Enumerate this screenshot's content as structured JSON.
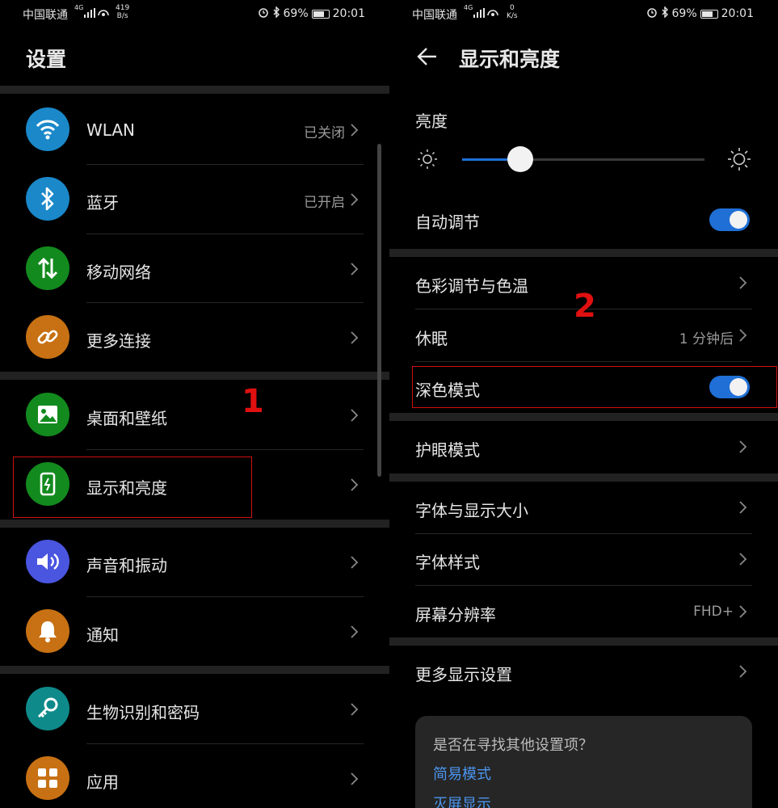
{
  "left": {
    "status": {
      "carrier": "中国联通",
      "net": "4G",
      "speed_num": "419",
      "speed_unit": "B/s",
      "battery": "69%",
      "time": "20:01"
    },
    "title": "设置",
    "items": [
      {
        "label": "WLAN",
        "value": "已关闭",
        "icon": "wifi-icon",
        "color": "#1a88c9"
      },
      {
        "label": "蓝牙",
        "value": "已开启",
        "icon": "bluetooth-icon",
        "color": "#1a88c9"
      },
      {
        "label": "移动网络",
        "value": "",
        "icon": "mobile-network-icon",
        "color": "#138a1e"
      },
      {
        "label": "更多连接",
        "value": "",
        "icon": "link-icon",
        "color": "#c77114"
      },
      {
        "label": "桌面和壁纸",
        "value": "",
        "icon": "wallpaper-icon",
        "color": "#138a1e"
      },
      {
        "label": "显示和亮度",
        "value": "",
        "icon": "display-icon",
        "color": "#138a1e"
      },
      {
        "label": "声音和振动",
        "value": "",
        "icon": "sound-icon",
        "color": "#4a55e0"
      },
      {
        "label": "通知",
        "value": "",
        "icon": "bell-icon",
        "color": "#c77114"
      },
      {
        "label": "生物识别和密码",
        "value": "",
        "icon": "key-icon",
        "color": "#0f8a8a"
      },
      {
        "label": "应用",
        "value": "",
        "icon": "apps-icon",
        "color": "#c77114"
      }
    ],
    "annotation": "1"
  },
  "right": {
    "status": {
      "carrier": "中国联通",
      "net": "4G",
      "speed_num": "0",
      "speed_unit": "K/s",
      "battery": "69%",
      "time": "20:01"
    },
    "title": "显示和亮度",
    "brightness_label": "亮度",
    "brightness_level": 0.24,
    "auto_adjust": "自动调节",
    "color_temp": "色彩调节与色温",
    "sleep": "休眠",
    "sleep_value": "1 分钟后",
    "dark_mode": "深色模式",
    "eye_care": "护眼模式",
    "font_size": "字体与显示大小",
    "font_style": "字体样式",
    "resolution": "屏幕分辨率",
    "resolution_value": "FHD+",
    "more_display": "更多显示设置",
    "card": {
      "question": "是否在寻找其他设置项？",
      "link1": "简易模式",
      "link2": "灭屏显示"
    },
    "annotation": "2",
    "accent_color": "#1f6fd6"
  }
}
